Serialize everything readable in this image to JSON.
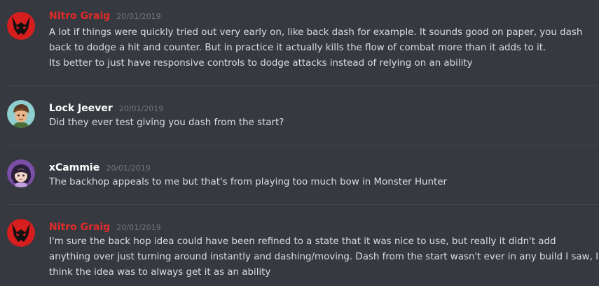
{
  "messages": [
    {
      "author": "Nitro Graig",
      "author_color": "#e02b2b",
      "timestamp": "20/01/2019",
      "avatar_icon": "nitro-red-demon-avatar-icon",
      "lines": [
        "A lot if things were quickly tried out very early on, like back dash for example. It sounds good on paper, you dash",
        "back to dodge a hit and counter. But in practice it actually kills the flow of combat more than it adds to it.",
        "Its better to just have responsive controls to dodge attacks instead of relying on an ability"
      ]
    },
    {
      "author": "Lock Jeever",
      "author_color": "#ffffff",
      "timestamp": "20/01/2019",
      "avatar_icon": "lock-jeever-avatar-icon",
      "lines": [
        "Did they ever test giving you dash from the start?"
      ]
    },
    {
      "author": "xCammie",
      "author_color": "#ffffff",
      "timestamp": "20/01/2019",
      "avatar_icon": "xcammie-avatar-icon",
      "lines": [
        "The backhop appeals to me but that's from playing too much bow in Monster Hunter"
      ]
    },
    {
      "author": "Nitro Graig",
      "author_color": "#e02b2b",
      "timestamp": "20/01/2019",
      "avatar_icon": "nitro-red-demon-avatar-icon",
      "lines": [
        "I'm sure the back hop idea could have been refined to a state that it was nice to use, but really it didn't add",
        "anything over just turning around instantly and dashing/moving. Dash from the start wasn't ever in any build I saw, I",
        "think the idea was to always get it as an ability"
      ]
    }
  ],
  "colors": {
    "background": "#36393f",
    "divider": "#40444b",
    "timestamp": "#72767d",
    "text": "#dcddde"
  }
}
